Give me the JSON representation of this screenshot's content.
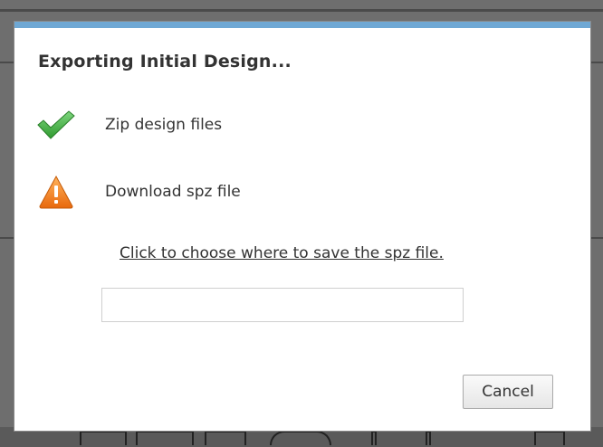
{
  "dialog": {
    "title": "Exporting Initial Design...",
    "steps": [
      {
        "label": "Zip design files",
        "status": "complete",
        "icon": "checkmark-icon",
        "color": "#3aa93a"
      },
      {
        "label": "Download spz file",
        "status": "warning",
        "icon": "warning-icon",
        "color": "#f07d1e"
      }
    ],
    "save_link": "Click to choose where to save the spz file.",
    "path_field": {
      "value": "",
      "placeholder": ""
    },
    "cancel_label": "Cancel"
  },
  "colors": {
    "accent": "#6fa8d4",
    "backdrop": "#6e6e6e",
    "text": "#333333"
  }
}
